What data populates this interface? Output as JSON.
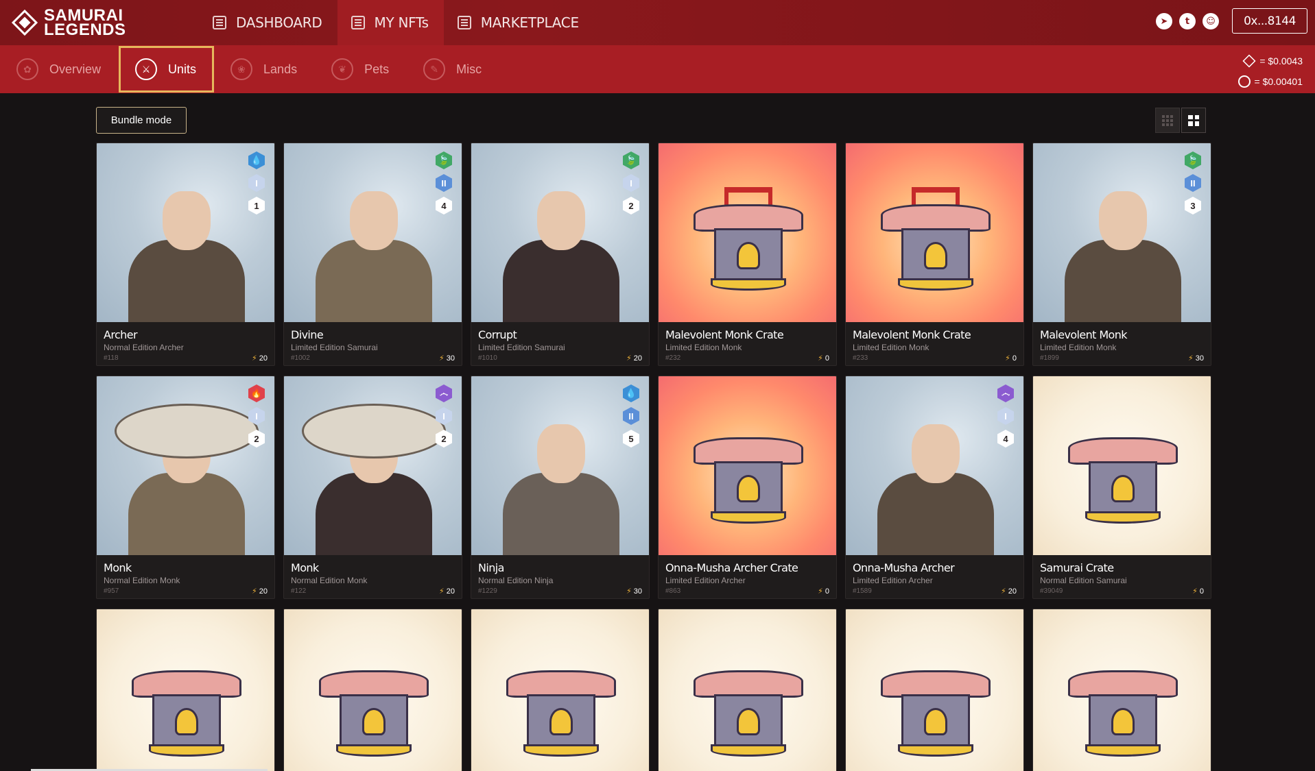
{
  "brand": {
    "line1": "SAMURAI",
    "line2": "LEGENDS"
  },
  "mainnav": [
    {
      "label": "DASHBOARD",
      "active": false
    },
    {
      "label": "MY NFTs",
      "active": true
    },
    {
      "label": "MARKETPLACE",
      "active": false
    }
  ],
  "socials": [
    "telegram-icon",
    "twitter-icon",
    "discord-icon"
  ],
  "wallet": {
    "label": "0x...8144"
  },
  "subnav": [
    {
      "label": "Overview",
      "active": false
    },
    {
      "label": "Units",
      "active": true
    },
    {
      "label": "Lands",
      "active": false
    },
    {
      "label": "Pets",
      "active": false
    },
    {
      "label": "Misc",
      "active": false
    }
  ],
  "prices": {
    "token1": "= $0.0043",
    "token2": "= $0.00401"
  },
  "toolbar": {
    "bundle_label": "Bundle mode"
  },
  "cards": [
    {
      "name": "Archer",
      "edition": "Normal Edition Archer",
      "id": "#118",
      "power": "20",
      "art": "blue",
      "element": "water",
      "tier": "I",
      "level": "1"
    },
    {
      "name": "Divine",
      "edition": "Limited Edition Samurai",
      "id": "#1002",
      "power": "30",
      "art": "blue",
      "element": "leaf",
      "tier": "II",
      "level": "4"
    },
    {
      "name": "Corrupt",
      "edition": "Limited Edition Samurai",
      "id": "#1010",
      "power": "20",
      "art": "blue",
      "element": "leaf",
      "tier": "I",
      "level": "2"
    },
    {
      "name": "Malevolent Monk Crate",
      "edition": "Limited Edition Monk",
      "id": "#232",
      "power": "0",
      "art": "fire"
    },
    {
      "name": "Malevolent Monk Crate",
      "edition": "Limited Edition Monk",
      "id": "#233",
      "power": "0",
      "art": "fire"
    },
    {
      "name": "Malevolent Monk",
      "edition": "Limited Edition Monk",
      "id": "#1899",
      "power": "30",
      "art": "blue",
      "element": "leaf",
      "tier": "II",
      "level": "3"
    },
    {
      "name": "Monk",
      "edition": "Normal Edition Monk",
      "id": "#957",
      "power": "20",
      "art": "blue",
      "element": "fire",
      "tier": "I",
      "level": "2"
    },
    {
      "name": "Monk",
      "edition": "Normal Edition Monk",
      "id": "#122",
      "power": "20",
      "art": "blue",
      "element": "wind",
      "tier": "I",
      "level": "2"
    },
    {
      "name": "Ninja",
      "edition": "Normal Edition Ninja",
      "id": "#1229",
      "power": "30",
      "art": "blue",
      "element": "water",
      "tier": "II",
      "level": "5"
    },
    {
      "name": "Onna-Musha Archer Crate",
      "edition": "Limited Edition Archer",
      "id": "#863",
      "power": "0",
      "art": "fire"
    },
    {
      "name": "Onna-Musha Archer",
      "edition": "Limited Edition Archer",
      "id": "#1589",
      "power": "20",
      "art": "blue",
      "element": "wind",
      "tier": "I",
      "level": "4"
    },
    {
      "name": "Samurai Crate",
      "edition": "Normal Edition Samurai",
      "id": "#39049",
      "power": "0",
      "art": "cream"
    },
    {
      "name": "",
      "edition": "",
      "id": "",
      "power": "",
      "art": "cream"
    },
    {
      "name": "",
      "edition": "",
      "id": "",
      "power": "",
      "art": "cream"
    },
    {
      "name": "",
      "edition": "",
      "id": "",
      "power": "",
      "art": "cream"
    },
    {
      "name": "",
      "edition": "",
      "id": "",
      "power": "",
      "art": "cream"
    },
    {
      "name": "",
      "edition": "",
      "id": "",
      "power": "",
      "art": "cream"
    },
    {
      "name": "",
      "edition": "",
      "id": "",
      "power": "",
      "art": "cream"
    }
  ]
}
